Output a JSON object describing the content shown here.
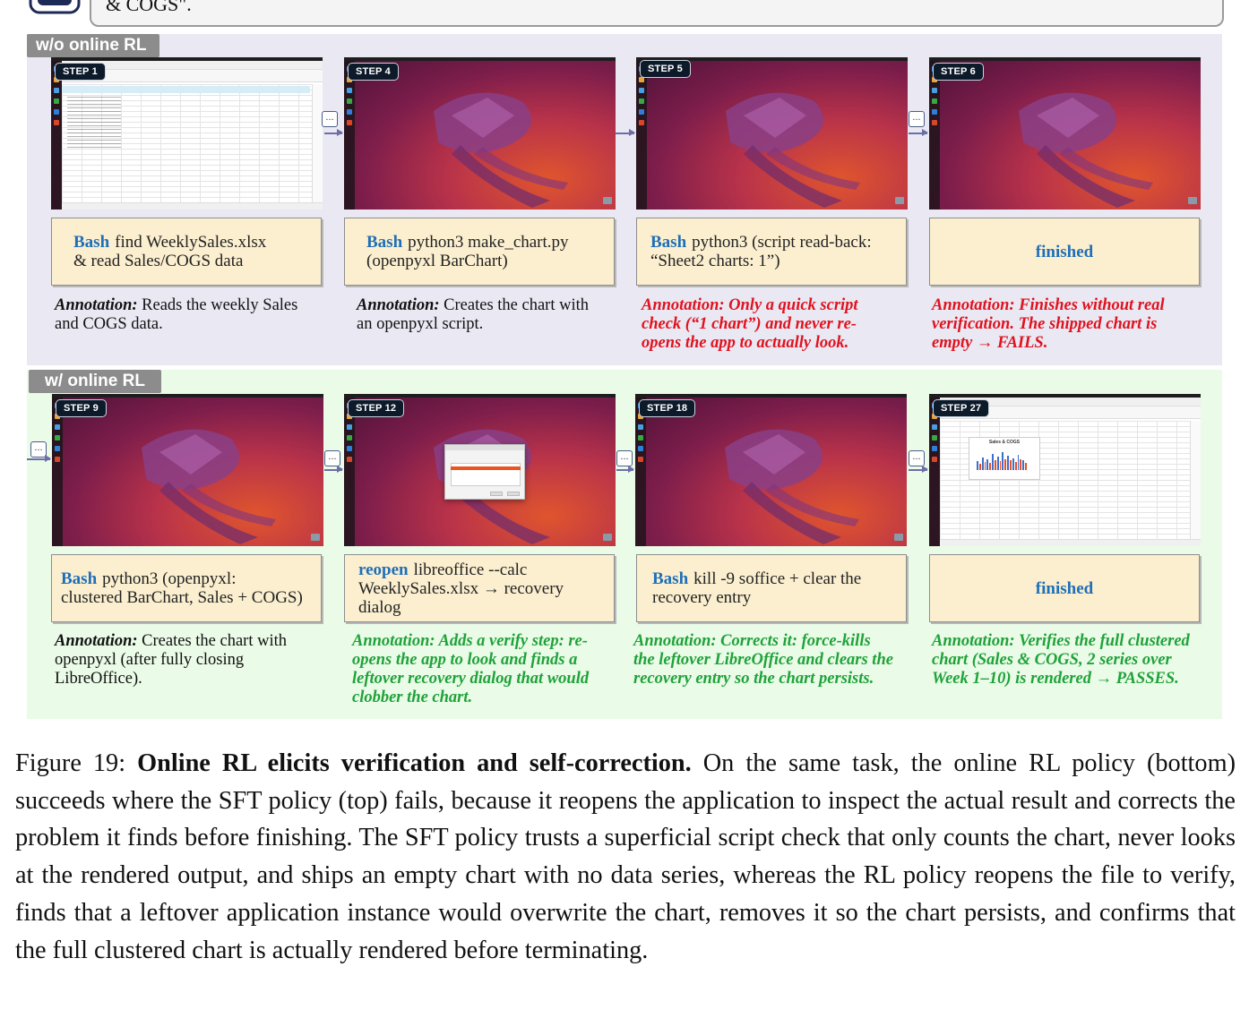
{
  "prompt": {
    "tail_text": "& COGS\"."
  },
  "panels": {
    "without_rl": {
      "label": "w/o online RL"
    },
    "with_rl": {
      "label": "w/ online RL"
    }
  },
  "top_steps": [
    {
      "badge": "STEP 1",
      "cmd": "Bash",
      "action_rest": "find WeeklySales.xlsx",
      "action_line2": "& read Sales/COGS data",
      "annot_lead": "Annotation:",
      "annot_text": "Reads the weekly Sales and COGS data."
    },
    {
      "badge": "STEP 4",
      "cmd": "Bash",
      "action_rest": "python3 make_chart.py",
      "action_line2": "(openpyxl BarChart)",
      "annot_lead": "Annotation:",
      "annot_text": "Creates the chart with an openpyxl script."
    },
    {
      "badge": "STEP 5",
      "cmd": "Bash",
      "action_rest": "python3   (script read-back:",
      "action_line2": "“Sheet2 charts: 1”)",
      "annot_full": "Annotation: Only a quick script check (“1 chart”) and never re-opens the app to actually look."
    },
    {
      "badge": "STEP 6",
      "finished": "finished",
      "annot_full": "Annotation: Finishes without real verification. The shipped chart is empty → FAILS."
    }
  ],
  "bottom_steps": [
    {
      "badge": "STEP 9",
      "cmd": "Bash",
      "action_rest": "python3   (openpyxl:",
      "action_line2": "clustered BarChart, Sales + COGS)",
      "annot_lead": "Annotation:",
      "annot_text": "Creates the chart with openpyxl (after fully closing LibreOffice)."
    },
    {
      "badge": "STEP 12",
      "cmd": "reopen",
      "action_rest": "libreoffice --calc",
      "action_line2": "WeeklySales.xlsx   → recovery",
      "action_line3": "dialog",
      "annot_full": "Annotation: Adds a verify step: re-opens the app to look and finds a leftover recovery dialog that would clobber the chart."
    },
    {
      "badge": "STEP 18",
      "cmd": "Bash",
      "action_rest": "kill -9 soffice  +  clear the",
      "action_line2": "recovery entry",
      "annot_full": "Annotation: Corrects it: force-kills the leftover LibreOffice and clears the recovery entry so the chart persists."
    },
    {
      "badge": "STEP 27",
      "finished": "finished",
      "chart_title": "Sales & COGS",
      "annot_full": "Annotation: Verifies the full clustered chart (Sales & COGS, 2 series over Week 1–10) is rendered → PASSES."
    }
  ],
  "connector_glyph": "...",
  "caption": {
    "prefix": "Figure 19:",
    "bold": "Online RL elicits verification and self-correction.",
    "text": "On the same task, the online RL policy (bottom) succeeds where the SFT policy (top) fails, because it reopens the application to inspect the actual result and corrects the problem it finds before finishing. The SFT policy trusts a superficial script check that only counts the chart, never looks at the rendered output, and ships an empty chart with no data series, whereas the RL policy reopens the file to verify, finds that a leftover application instance would overwrite the chart, removes it so the chart persists, and confirms that the full clustered chart is actually rendered before terminating."
  },
  "colors": {
    "command_blue": "#1f6fb8",
    "fail_red": "#e0121e",
    "pass_green": "#1fa23a",
    "action_fill": "#fbefcf"
  }
}
